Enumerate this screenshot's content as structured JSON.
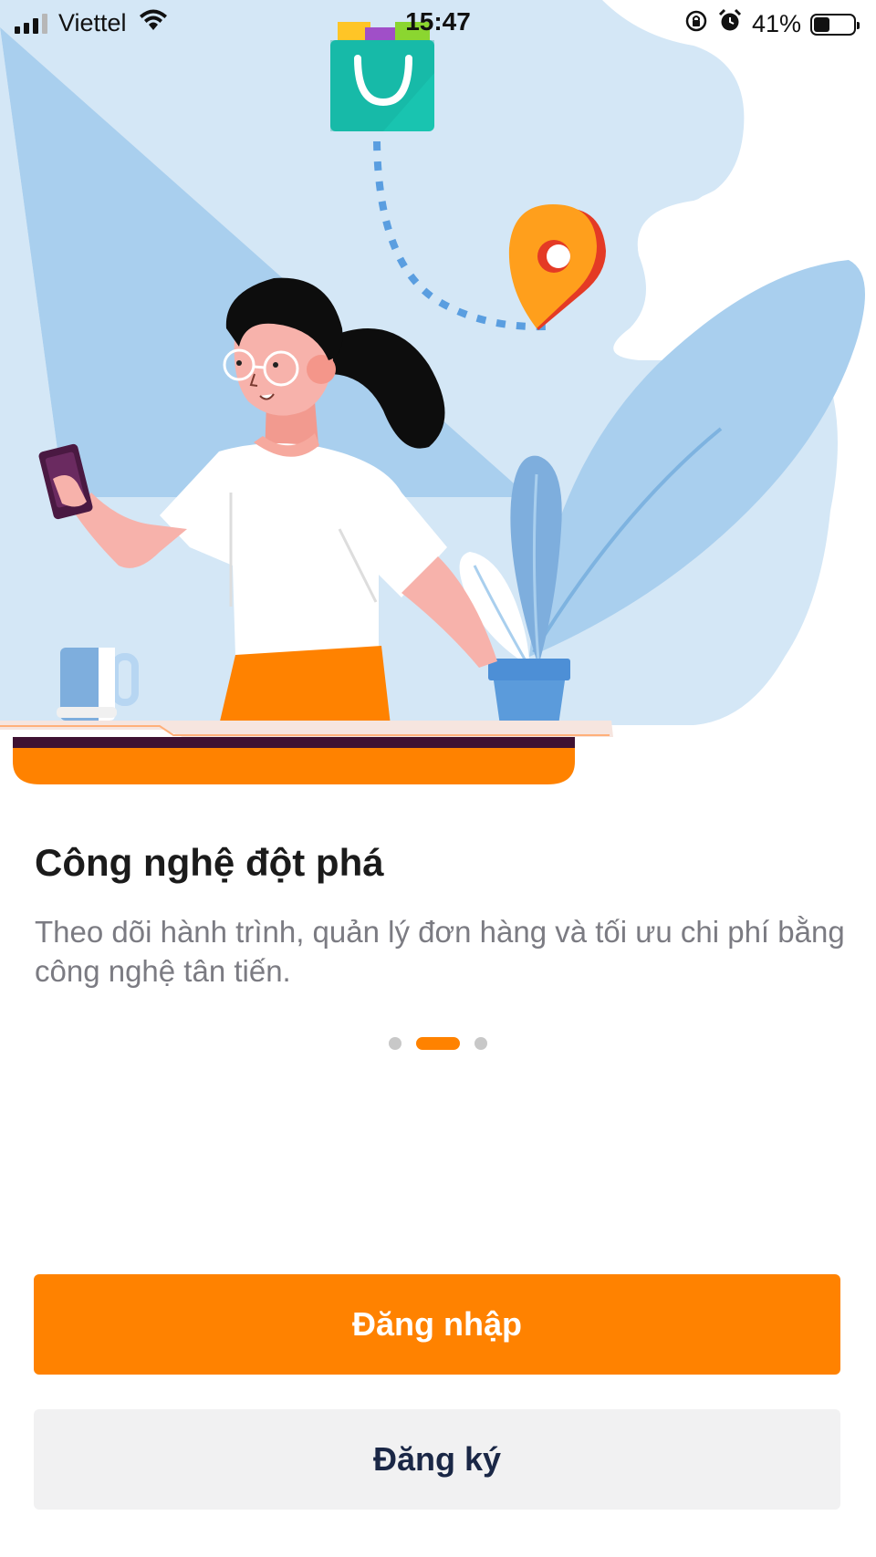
{
  "status_bar": {
    "carrier": "Viettel",
    "time": "15:47",
    "battery_percent": "41%",
    "battery_level": 0.41,
    "icons": [
      "signal-icon",
      "wifi-icon",
      "rotation-lock-icon",
      "alarm-icon",
      "battery-icon"
    ]
  },
  "onboarding": {
    "illustration": "woman-with-phone-shopping-bag-location-pin",
    "title": "Công nghệ đột phá",
    "description": "Theo dõi hành trình, quản lý đơn hàng và tối ưu chi phí bằng công nghệ tân tiến.",
    "page_count": 3,
    "active_page": 2
  },
  "actions": {
    "login_label": "Đăng nhập",
    "register_label": "Đăng ký"
  },
  "colors": {
    "accent": "#ff8200",
    "secondary_button_bg": "#f1f1f2",
    "secondary_button_text": "#1a2746",
    "illustration_blue": "#a9cfee",
    "illustration_light_blue": "#d4e7f6"
  }
}
